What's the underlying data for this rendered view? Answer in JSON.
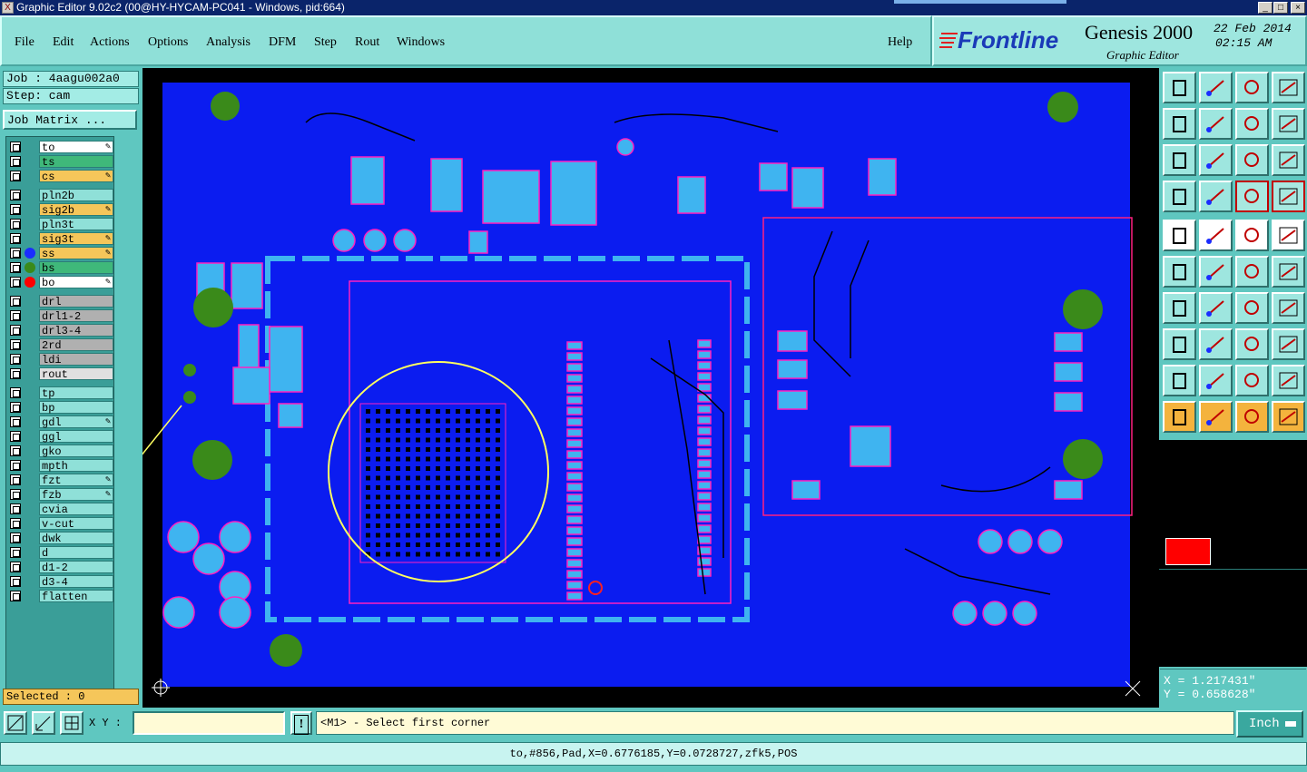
{
  "window": {
    "title": "Graphic Editor 9.02c2 (00@HY-HYCAM-PC041 - Windows, pid:664)",
    "controls": [
      "_",
      "□",
      "×"
    ]
  },
  "menu": {
    "items": [
      "File",
      "Edit",
      "Actions",
      "Options",
      "Analysis",
      "DFM",
      "Step",
      "Rout",
      "Windows"
    ],
    "help": "Help"
  },
  "branding": {
    "logo": "Frontline",
    "product": "Genesis 2000",
    "subtitle": "Graphic Editor",
    "date": "22 Feb 2014",
    "time": "02:15 AM"
  },
  "job": {
    "job_label": "Job : 4aagu002a0",
    "step_label": "Step: cam",
    "matrix_button": "Job Matrix ..."
  },
  "layers": [
    {
      "name": "to",
      "bg": "#ffffff",
      "edit": true,
      "dot": ""
    },
    {
      "name": "ts",
      "bg": "#3fb87a",
      "edit": false,
      "dot": ""
    },
    {
      "name": "cs",
      "bg": "#f5c65a",
      "edit": true,
      "dot": ""
    },
    {
      "name": "pln2b",
      "bg": "#8fe0d8",
      "edit": false,
      "dot": ""
    },
    {
      "name": "sig2b",
      "bg": "#f5c65a",
      "edit": true,
      "dot": ""
    },
    {
      "name": "pln3t",
      "bg": "#8fe0d8",
      "edit": false,
      "dot": ""
    },
    {
      "name": "sig3t",
      "bg": "#f5c65a",
      "edit": true,
      "dot": ""
    },
    {
      "name": "ss",
      "bg": "#f5c65a",
      "edit": true,
      "dot": "#1a2cff"
    },
    {
      "name": "bs",
      "bg": "#3fb87a",
      "edit": false,
      "dot": "#3a8a1a"
    },
    {
      "name": "bo",
      "bg": "#ffffff",
      "edit": true,
      "dot": "#ff0000"
    },
    {
      "name": "drl",
      "bg": "#b0b0b0",
      "edit": false,
      "dot": ""
    },
    {
      "name": "drl1-2",
      "bg": "#b0b0b0",
      "edit": false,
      "dot": ""
    },
    {
      "name": "drl3-4",
      "bg": "#b0b0b0",
      "edit": false,
      "dot": ""
    },
    {
      "name": "2rd",
      "bg": "#b0b0b0",
      "edit": false,
      "dot": ""
    },
    {
      "name": "ldi",
      "bg": "#b0b0b0",
      "edit": false,
      "dot": ""
    },
    {
      "name": "rout",
      "bg": "#e0e0e0",
      "edit": false,
      "dot": ""
    },
    {
      "name": "tp",
      "bg": "#8fe0d8",
      "edit": false,
      "dot": ""
    },
    {
      "name": "bp",
      "bg": "#8fe0d8",
      "edit": false,
      "dot": ""
    },
    {
      "name": "gdl",
      "bg": "#8fe0d8",
      "edit": true,
      "dot": ""
    },
    {
      "name": "ggl",
      "bg": "#8fe0d8",
      "edit": false,
      "dot": ""
    },
    {
      "name": "gko",
      "bg": "#8fe0d8",
      "edit": false,
      "dot": ""
    },
    {
      "name": "mpth",
      "bg": "#8fe0d8",
      "edit": false,
      "dot": ""
    },
    {
      "name": "fzt",
      "bg": "#8fe0d8",
      "edit": true,
      "dot": ""
    },
    {
      "name": "fzb",
      "bg": "#8fe0d8",
      "edit": true,
      "dot": ""
    },
    {
      "name": "cvia",
      "bg": "#8fe0d8",
      "edit": false,
      "dot": ""
    },
    {
      "name": "v-cut",
      "bg": "#8fe0d8",
      "edit": false,
      "dot": ""
    },
    {
      "name": "dwk",
      "bg": "#8fe0d8",
      "edit": false,
      "dot": ""
    },
    {
      "name": "d",
      "bg": "#8fe0d8",
      "edit": false,
      "dot": ""
    },
    {
      "name": "d1-2",
      "bg": "#8fe0d8",
      "edit": false,
      "dot": ""
    },
    {
      "name": "d3-4",
      "bg": "#8fe0d8",
      "edit": false,
      "dot": ""
    },
    {
      "name": "flatten",
      "bg": "#8fe0d8",
      "edit": false,
      "dot": ""
    }
  ],
  "selected": "Selected : 0",
  "coords": {
    "x": "X =  1.217431\"",
    "y": "Y =  0.658628\""
  },
  "bottom": {
    "xy_label": "X Y :",
    "xy_value": "",
    "prompt": "<M1> - Select first corner",
    "units": "Inch"
  },
  "status": "to,#856,Pad,X=0.6776185,Y=0.0728727,zfk5,POS",
  "colors": {
    "board": "#0b1cf0",
    "pad": "#3fb4f0",
    "outline": "#ff20c0",
    "green": "#3a8a1a",
    "yellow": "#ffff60"
  },
  "toolbar_icons": [
    "zoom-page-icon",
    "zoom-home-icon",
    "home-icon",
    "split-window-icon",
    "pan-left-icon",
    "pan-right-icon",
    "undo-icon",
    "redraw-icon",
    "fit-icon",
    "center-icon",
    "scale-1-2-icon",
    "help-icon",
    "snap-icon",
    "grid-icon",
    "layers-icon",
    "layers-alt-icon",
    "pad-icon",
    "measure-icon",
    "ruler-icon",
    "circle-icon",
    "net-icon",
    "cross-icon",
    "move-icon",
    "rotate-icon",
    "line-icon",
    "slash-icon",
    "arc-icon",
    "text-icon",
    "copy-icon",
    "mirror-icon",
    "scale-icon",
    "feature-icon",
    "triangle-icon",
    "triangle-alt-icon",
    "arch-icon",
    "arch-alt-icon",
    "select-icon",
    "select-box-icon",
    "select-in-icon",
    "select-net-icon"
  ]
}
